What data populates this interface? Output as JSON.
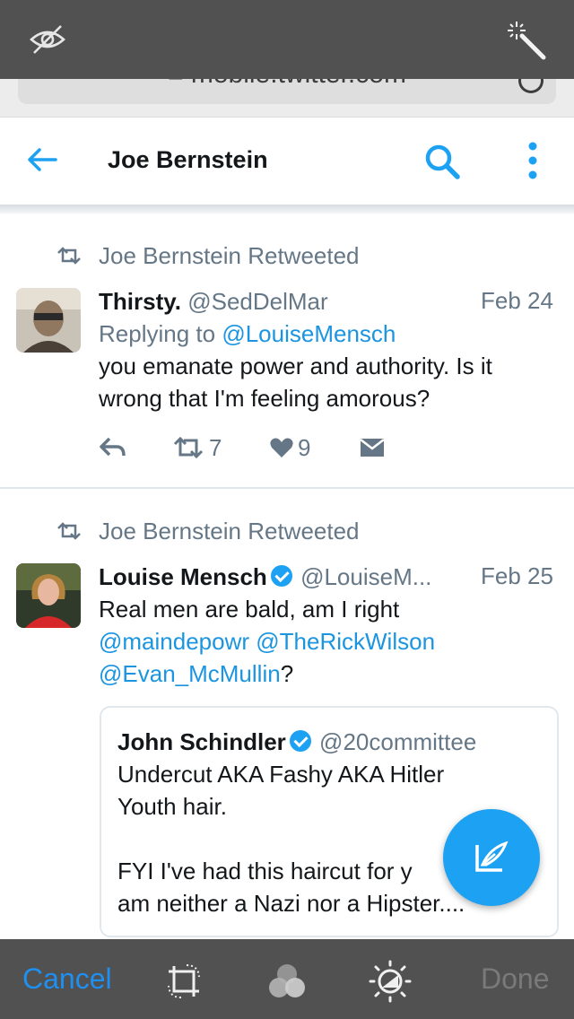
{
  "editor": {
    "cancel_label": "Cancel",
    "done_label": "Done",
    "url_partial": "≡ mobile.twitter.com"
  },
  "header": {
    "title": "Joe Bernstein"
  },
  "tweets": [
    {
      "retweeted_by": "Joe Bernstein Retweeted",
      "name": "Thirsty.",
      "handle": "@SedDelMar",
      "date": "Feb 24",
      "reply_prefix": "Replying to",
      "reply_to": "@LouiseMensch",
      "text_line1": "you emanate power and authority. Is it",
      "text_line2": "wrong that I'm feeling amorous?",
      "retweets": "7",
      "likes": "9"
    },
    {
      "retweeted_by": "Joe Bernstein Retweeted",
      "name": "Louise Mensch",
      "handle": "@LouiseM...",
      "date": "Feb 25",
      "text_line1": "Real men are bald, am I right",
      "mention1": "@maindepowr",
      "mention2": "@TheRickWilson",
      "mention3": "@Evan_McMullin",
      "trail": "?",
      "quote": {
        "name": "John Schindler",
        "handle": "@20committee",
        "line1": "Undercut AKA Fashy AKA Hitler",
        "line2": "Youth hair.",
        "line3": "FYI I've had this haircut for y",
        "line4": "am neither a Nazi nor a Hipster...."
      }
    }
  ],
  "colors": {
    "accent": "#1da1f2",
    "link": "#1b95e0",
    "muted": "#657786",
    "editor_bar": "#505150",
    "cancel": "#1f8ff0"
  }
}
